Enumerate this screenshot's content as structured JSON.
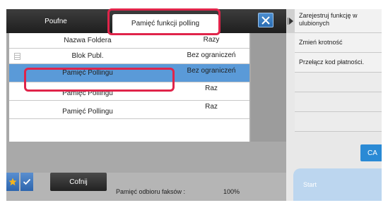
{
  "tabs": {
    "poufne": "Poufne",
    "polling": "Pamięć funkcji polling"
  },
  "close_icon": "close-icon",
  "table": {
    "rows": [
      {
        "name": "Nazwa Foldera",
        "value": "Razy",
        "icon": false,
        "selected": false
      },
      {
        "name": "Blok Publ.",
        "value": "Bez ograniczeń",
        "icon": true,
        "selected": false
      },
      {
        "name": "Pamięć Pollingu",
        "value": "Bez ograniczeń",
        "icon": false,
        "selected": true
      },
      {
        "name": "Pamięć Pollingu",
        "value": "Raz",
        "icon": false,
        "selected": false
      },
      {
        "name": "Pamięć Pollingu",
        "value": "Raz",
        "icon": false,
        "selected": false
      }
    ]
  },
  "bottom": {
    "cofnij": "Cofnij",
    "fax_label": "Pamięć odbioru faksów :",
    "fax_percent": "100%"
  },
  "right": {
    "menu": [
      "Zarejestruj funkcję w ulubionych",
      "Zmień krotność",
      "Przełącz kod płatności."
    ],
    "ca": "CA",
    "start": "Start"
  },
  "colors": {
    "highlight": "#e0244a",
    "selected_row": "#5a9ad8",
    "ca_button": "#2a8ad5"
  }
}
